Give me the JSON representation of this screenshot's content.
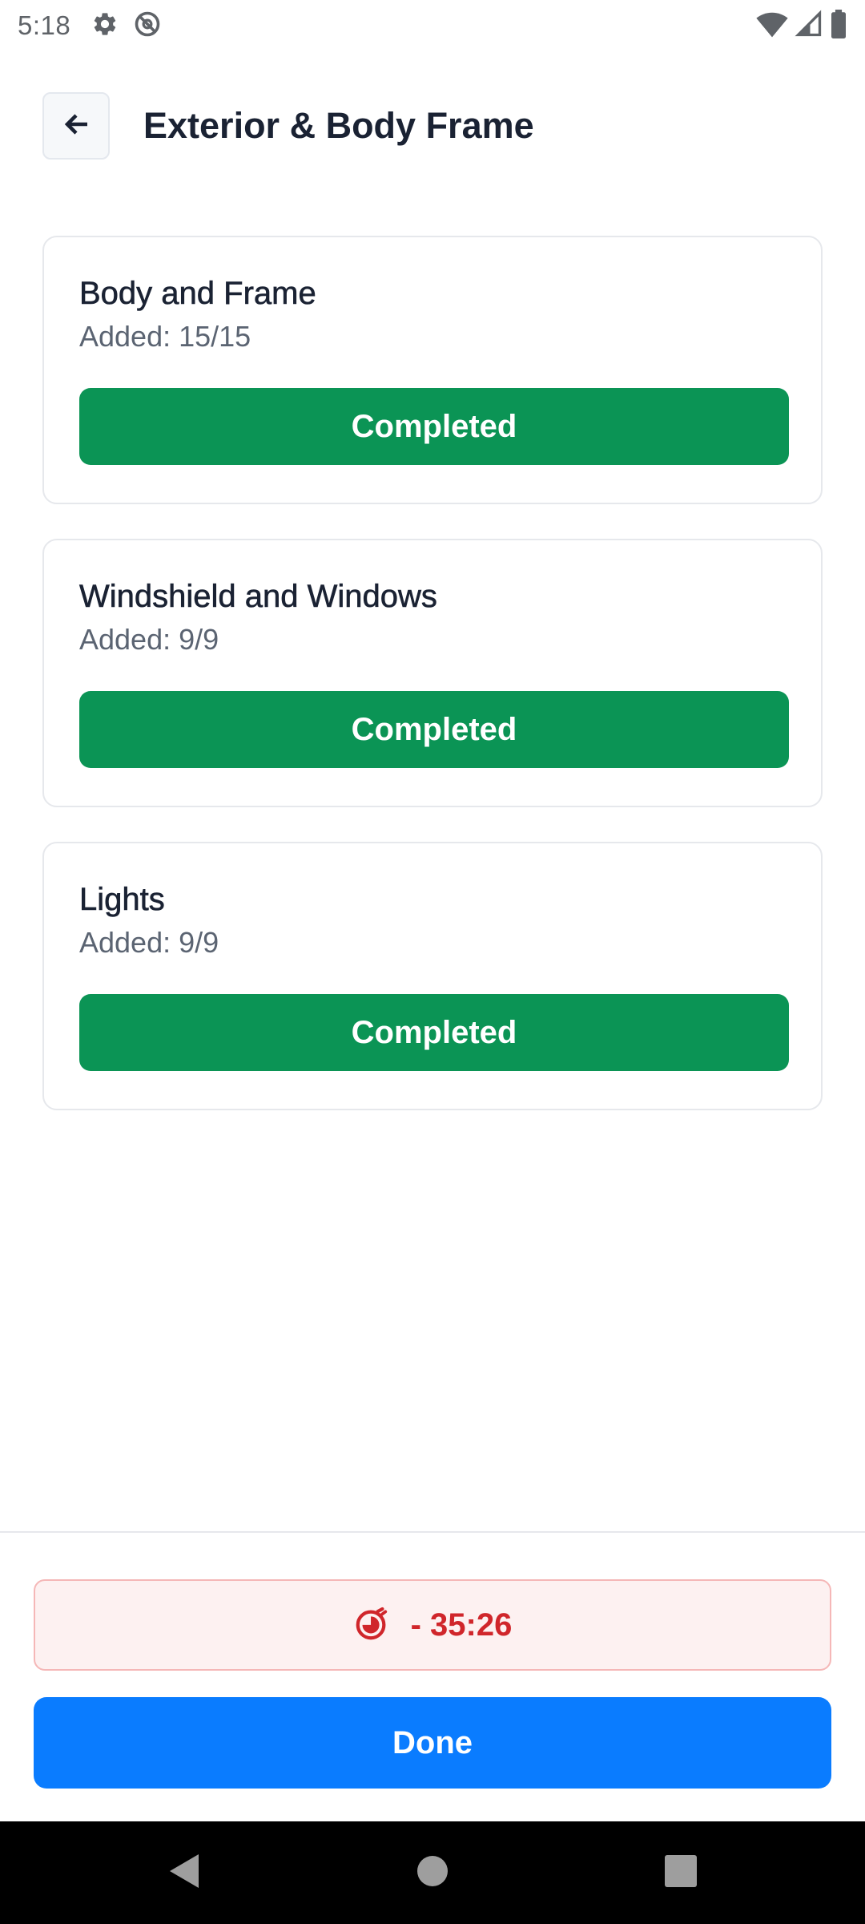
{
  "status_bar": {
    "time": "5:18",
    "left_icons": [
      "gear-icon",
      "do-not-disturb-icon"
    ],
    "right_icons": [
      "wifi-icon",
      "cellular-signal-icon",
      "battery-icon"
    ]
  },
  "header": {
    "back_icon": "arrow-left-icon",
    "title": "Exterior & Body Frame"
  },
  "cards": [
    {
      "title": "Body and Frame",
      "subtitle": "Added: 15/15",
      "button_label": "Completed"
    },
    {
      "title": "Windshield and Windows",
      "subtitle": "Added: 9/9",
      "button_label": "Completed"
    },
    {
      "title": "Lights",
      "subtitle": "Added: 9/9",
      "button_label": "Completed"
    }
  ],
  "timer": {
    "icon": "stopwatch-icon",
    "value": "- 35:26"
  },
  "done_button": {
    "label": "Done"
  },
  "nav_bar": {
    "icons": [
      "back-triangle-icon",
      "home-circle-icon",
      "recents-square-icon"
    ]
  },
  "colors": {
    "completed_green": "#0b9455",
    "done_blue": "#0a7cff",
    "timer_red": "#d0262b",
    "timer_bg": "#fdf1f1"
  }
}
